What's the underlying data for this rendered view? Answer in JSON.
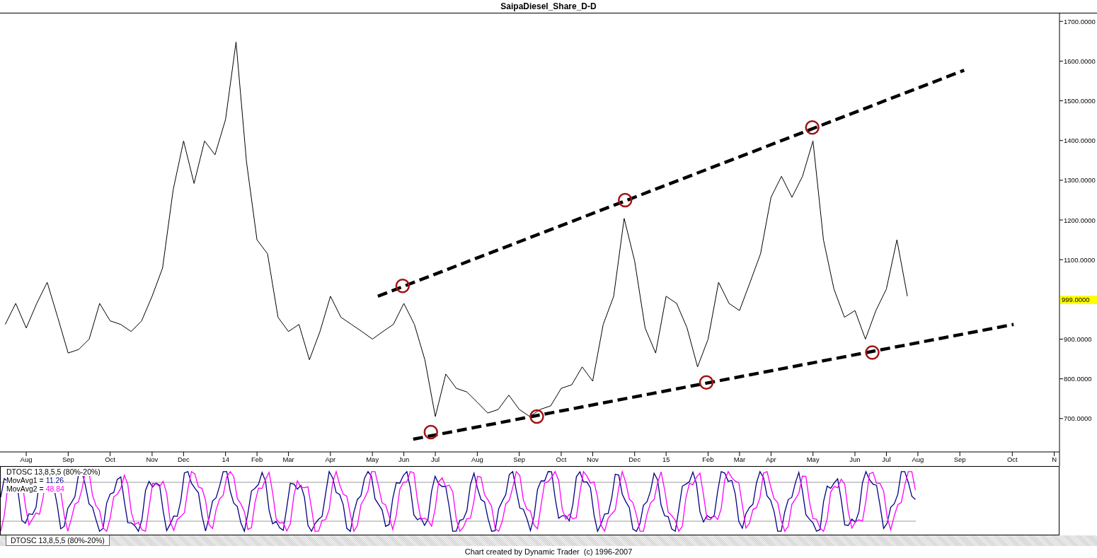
{
  "title": "SaipaDiesel_Share_D-D",
  "price_chart": {
    "last_price_label": "999.0000",
    "chart_data": {
      "type": "line",
      "ylim": [
        616,
        1720
      ],
      "yticks": [
        {
          "value": 700,
          "label": "700.0000"
        },
        {
          "value": 800,
          "label": "800.0000"
        },
        {
          "value": 900,
          "label": "900.0000"
        },
        {
          "value": 1100,
          "label": "1100.0000"
        },
        {
          "value": 1200,
          "label": "1200.0000"
        },
        {
          "value": 1300,
          "label": "1300.0000"
        },
        {
          "value": 1400,
          "label": "1400.0000"
        },
        {
          "value": 1500,
          "label": "1500.0000"
        },
        {
          "value": 1600,
          "label": "1600.0000"
        },
        {
          "value": 1700,
          "label": "1700.0000"
        }
      ],
      "categories": [
        null,
        null,
        "Aug",
        null,
        null,
        null,
        "Sep",
        null,
        null,
        null,
        "Oct",
        null,
        null,
        null,
        "Nov",
        null,
        null,
        "Dec",
        null,
        null,
        null,
        "14",
        null,
        null,
        "Feb",
        null,
        null,
        "Mar",
        null,
        null,
        null,
        "Apr",
        null,
        null,
        null,
        "May",
        null,
        null,
        "Jun",
        null,
        null,
        "Jul",
        null,
        null,
        null,
        "Aug",
        null,
        null,
        null,
        "Sep",
        null,
        null,
        null,
        "Oct",
        null,
        null,
        "Nov",
        null,
        null,
        null,
        "Dec",
        null,
        null,
        "15",
        null,
        null,
        null,
        "Feb",
        null,
        null,
        "Mar",
        null,
        null,
        "Apr",
        null,
        null,
        null,
        "May",
        null,
        null,
        null,
        "Jun",
        null,
        null,
        "Jul",
        null,
        null,
        "Aug",
        null,
        null,
        null,
        "Sep",
        null,
        null,
        null,
        null,
        "Oct",
        null,
        null,
        null,
        "N"
      ],
      "series": [
        {
          "color": "#000000",
          "values": [
            937,
            990,
            928,
            990,
            1043,
            955,
            865,
            874,
            900,
            990,
            946,
            937,
            919,
            946,
            1008,
            1079,
            1275,
            1399,
            1292,
            1399,
            1364,
            1453,
            1648,
            1346,
            1150,
            1115,
            955,
            919,
            937,
            848,
            919,
            1008,
            955,
            937,
            919,
            900,
            919,
            937,
            990,
            937,
            848,
            705,
            812,
            776,
            767,
            741,
            714,
            723,
            759,
            723,
            705,
            723,
            732,
            776,
            785,
            830,
            794,
            937,
            1008,
            1204,
            1097,
            928,
            865,
            1008,
            990,
            928,
            830,
            900,
            1043,
            990,
            972,
            1043,
            1115,
            1257,
            1310,
            1257,
            1310,
            1399,
            1150,
            1026,
            955,
            972,
            900,
            972,
            1026,
            1150,
            1008,
            null,
            null,
            null,
            null,
            null,
            null,
            null,
            null,
            null,
            null,
            null,
            null,
            null,
            null
          ]
        }
      ]
    }
  },
  "oscillator": {
    "name": "DTOSC 13,8,5,5 (80%-20%)",
    "lines": [
      {
        "label": "MovAvg1 =",
        "value": "11.26",
        "color": "#000080"
      },
      {
        "label": "MovAvg2 =",
        "value": "48.84",
        "color": "#ff00ff"
      }
    ]
  },
  "tabs": [
    {
      "label": "DTOSC 13,8,5,5 (80%-20%)",
      "selected": true
    }
  ],
  "footer": "Chart created by Dynamic Trader  (c) 1996-2007"
}
